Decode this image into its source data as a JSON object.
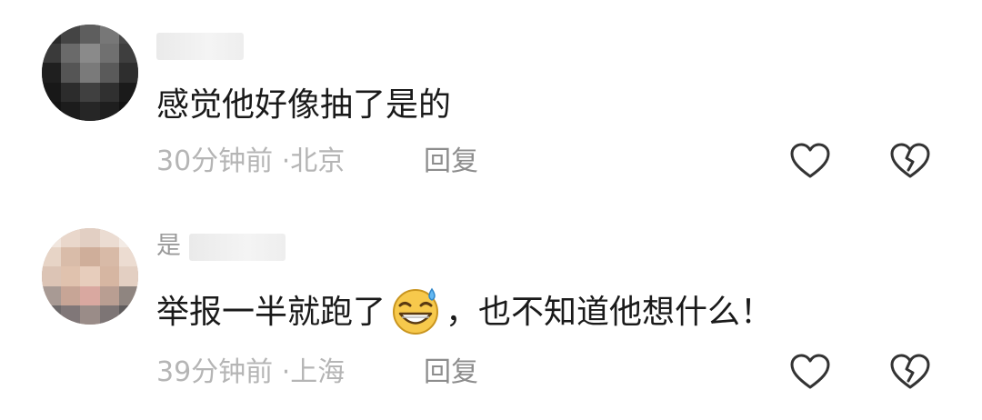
{
  "comments": [
    {
      "username": "",
      "text": "感觉他好像抽了是的",
      "time": "30分钟前",
      "separator": "·",
      "location": "北京",
      "reply_label": "回复"
    },
    {
      "username": "是",
      "text_before": "举报一半就跑了",
      "emoji": "grinning-sweat-emoji",
      "text_after": "，也不知道他想什么！",
      "time": "39分钟前",
      "separator": "·",
      "location": "上海",
      "reply_label": "回复"
    }
  ],
  "icons": {
    "like": "heart-outline-icon",
    "dislike": "broken-heart-icon"
  },
  "colors": {
    "text": "#1a1a1a",
    "meta": "#b5b5b5",
    "reply": "#8d8d8d",
    "icon": "#333333"
  }
}
